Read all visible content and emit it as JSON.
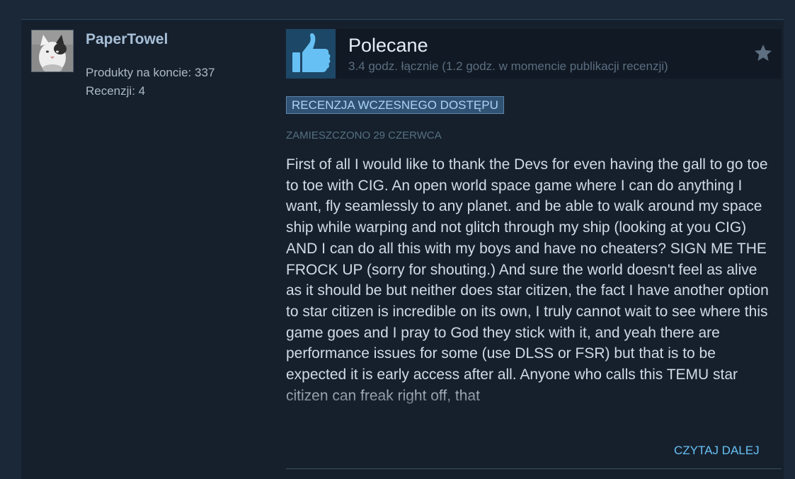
{
  "author": {
    "name": "PaperTowel",
    "products_label": "Produkty na koncie: 337",
    "reviews_label": "Recenzji: 4"
  },
  "review": {
    "verdict": "Polecane",
    "hours": "3.4 godz. łącznie (1.2 godz. w momencie publikacji recenzji)",
    "badge": "RECENZJA WCZESNEGO DOSTĘPU",
    "posted": "ZAMIESZCZONO 29 CZERWCA",
    "text": "First of all I would like to thank the Devs for even having the gall to go toe to toe with CIG. An open world space game where I can do anything I want, fly seamlessly to any planet. and be able to walk around my space ship while warping and not glitch through my ship (looking at you CIG) AND I can do all this with my boys and have no cheaters? SIGN ME THE FROCK UP (sorry for shouting.) And sure the world doesn't feel as alive as it should be but neither does star citizen, the fact I have another option to star citizen is incredible on its own, I truly cannot wait to see where this game goes and I pray to God they stick with it, and yeah there are performance issues for some (use DLSS or FSR) but that is to be expected it is early access after all. Anyone who calls this TEMU star citizen can freak right off, that",
    "read_more": "CZYTAJ DALEJ"
  },
  "icons": {
    "thumb": "thumbs-up-icon",
    "award": "star-icon"
  },
  "colors": {
    "background": "#1b2838",
    "card": "#16202d",
    "link": "#66c0f4",
    "thumb": "#66c0f4"
  }
}
